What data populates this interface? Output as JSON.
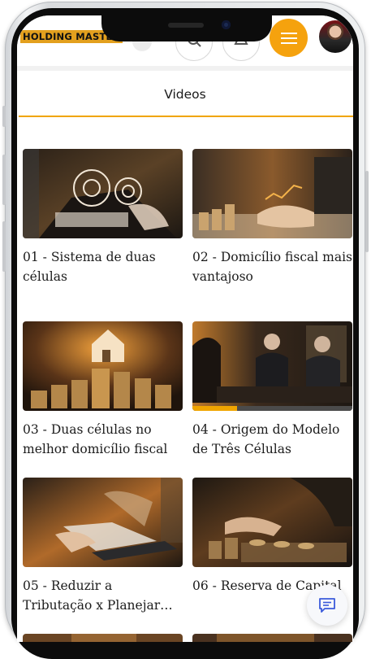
{
  "header": {
    "logo_text": "HOLDING MASTER",
    "menu_icon": "hamburger-icon",
    "search_icon": "search-icon",
    "notification_icon": "bell-icon",
    "accent_color": "#f5a20e"
  },
  "tabs": {
    "active_label": "Videos"
  },
  "videos": [
    {
      "title": "01 - Sistema de duas células",
      "progress": 0
    },
    {
      "title": "02 - Domicílio fiscal mais vantajoso",
      "progress": 0
    },
    {
      "title": "03 - Duas células no melhor domicílio fiscal",
      "progress": 0
    },
    {
      "title": "04 - Origem do Modelo de Três Células",
      "progress": 0.28
    },
    {
      "title": "05 - Reduzir a Tributação x Planejar a...",
      "progress": 0
    },
    {
      "title": "06 - Reserva de Capital",
      "progress": 0
    }
  ],
  "chat": {
    "icon": "chat-icon"
  }
}
